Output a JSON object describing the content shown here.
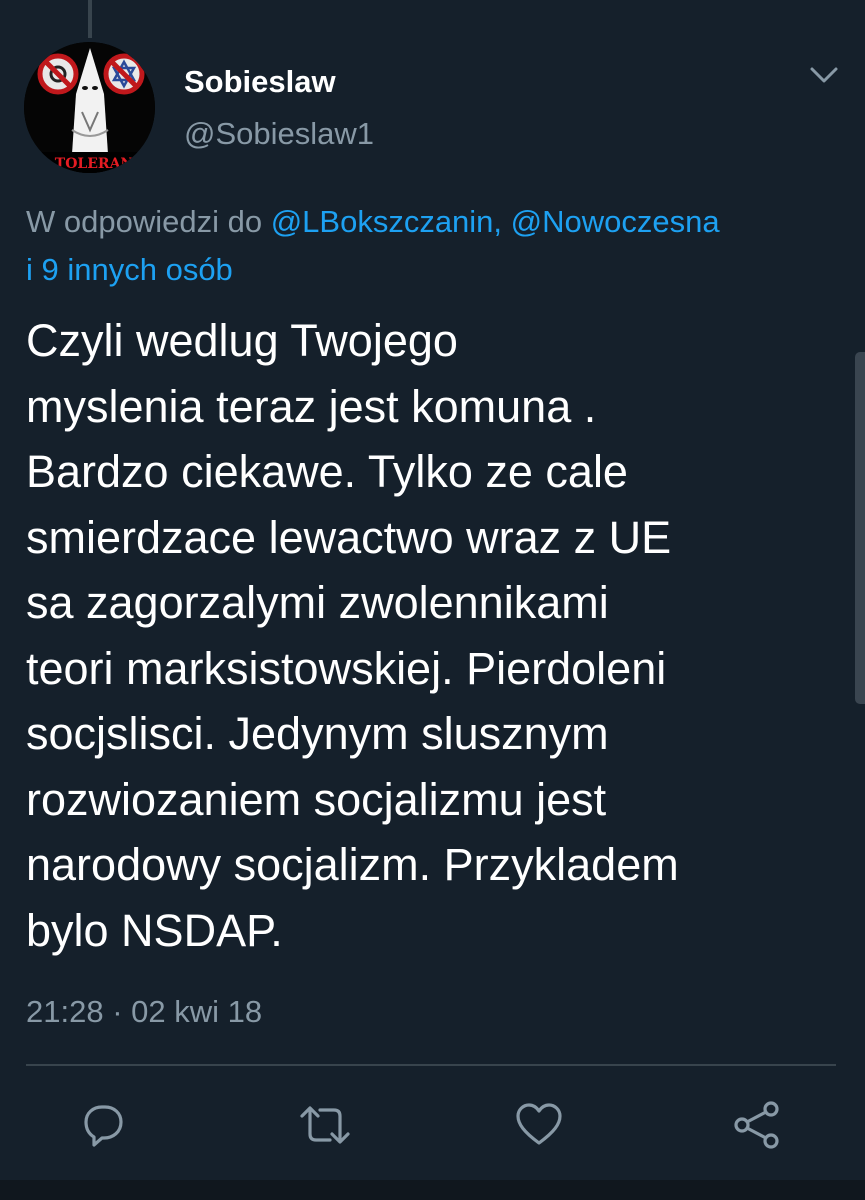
{
  "tweet": {
    "author": {
      "display_name": "Sobieslaw",
      "handle": "@Sobieslaw1",
      "avatar_text": "NO TOLERANCE"
    },
    "reply_to": {
      "prefix": "W odpowiedzi do ",
      "mentions": "@LBokszczanin, @Nowoczesna",
      "others": "i 9 innych osób"
    },
    "text": "Czyli wedlug Twojego\nmyslenia teraz jest komuna .\nBardzo ciekawe. Tylko ze cale\nsmierdzace lewactwo wraz z UE\nsa zagorzalymi zwolennikami\nteori marksistowskiej. Pierdoleni\nsocjslisci. Jedynym slusznym\nrozwiozaniem socjalizmu jest\nnarodowy socjalizm. Przykladem\nbylo NSDAP.",
    "timestamp": "21:28 · 02 kwi 18"
  },
  "actions": [
    {
      "name": "reply",
      "icon": "comment-icon"
    },
    {
      "name": "retweet",
      "icon": "retweet-icon"
    },
    {
      "name": "like",
      "icon": "heart-icon"
    },
    {
      "name": "share",
      "icon": "share-icon"
    }
  ],
  "colors": {
    "background": "#15202b",
    "text": "#ffffff",
    "secondary": "#8899a6",
    "link": "#1da1f2",
    "divider": "#38444d"
  }
}
